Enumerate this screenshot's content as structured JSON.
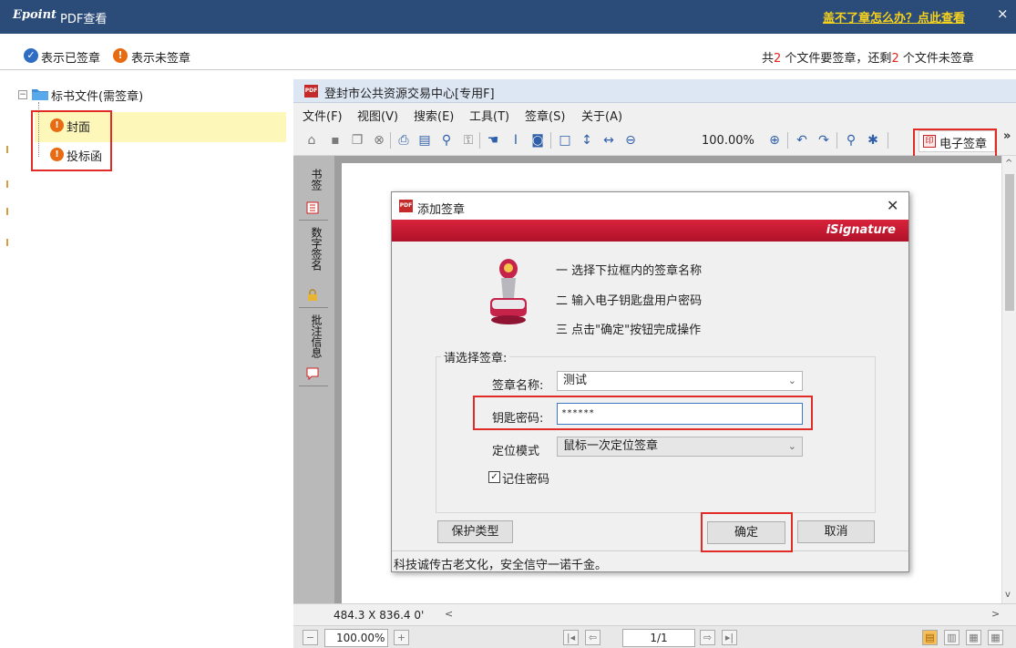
{
  "titlebar": {
    "logo": "Epoint",
    "title": "PDF查看",
    "help_link": "盖不了章怎么办？点此查看",
    "close": "×"
  },
  "status": {
    "legend_signed": "表示已签章",
    "legend_unsigned": "表示未签章",
    "counts_prefix": "共",
    "total_count": "2",
    "counts_mid": " 个文件要签章，还剩",
    "remaining_count": "2",
    "counts_suffix": " 个文件未签章"
  },
  "tree": {
    "root": "标书文件(需签章)",
    "items": [
      {
        "label": "封面"
      },
      {
        "label": "投标函"
      }
    ]
  },
  "viewer": {
    "title": "登封市公共资源交易中心[专用F]",
    "menu": [
      "文件(F)",
      "视图(V)",
      "搜索(E)",
      "工具(T)",
      "签章(S)",
      "关于(A)"
    ],
    "zoom": "100.00%",
    "esign_button": "电子签章",
    "side_tabs": [
      "书签",
      "数字签名",
      "批注信息"
    ],
    "page_size": "484.3 X 836.4 0'",
    "nav_zoom": "100.00%",
    "nav_page": "1/1"
  },
  "dialog": {
    "title": "添加签章",
    "brand": "iSignature",
    "steps": [
      "一 选择下拉框内的签章名称",
      "二 输入电子钥匙盘用户密码",
      "三 点击\"确定\"按钮完成操作"
    ],
    "group_title": "请选择签章:",
    "name_label": "签章名称:",
    "name_value": "测试",
    "password_label": "钥匙密码:",
    "password_value": "******",
    "mode_label": "定位模式",
    "mode_value": "鼠标一次定位签章",
    "remember_label": "记住密码",
    "protect_button": "保护类型",
    "ok_button": "确定",
    "cancel_button": "取消",
    "footer": "科技诚传古老文化，安全信守一诺千金。"
  },
  "colors": {
    "titlebar": "#2b4c78",
    "help_link": "#f7d21d",
    "signed": "#2f6dc4",
    "unsigned": "#e86a13",
    "highlight": "#e02b26",
    "banner": "#c41a32"
  }
}
